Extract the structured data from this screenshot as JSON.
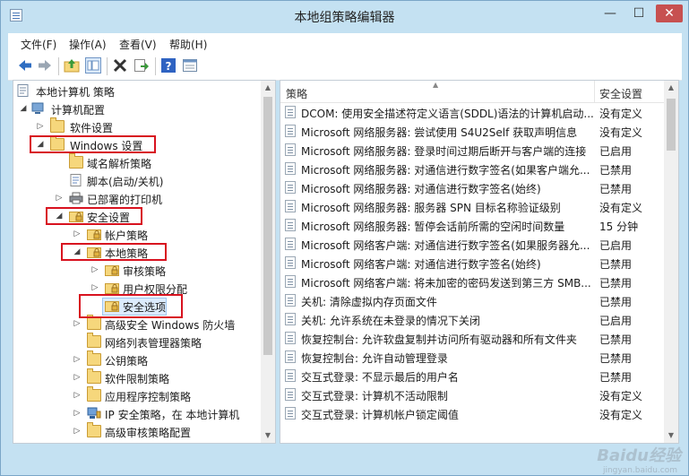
{
  "window": {
    "title": "本地组策略编辑器",
    "controls": {
      "minimize": "—",
      "maximize": "☐",
      "close": "✕"
    }
  },
  "menubar": [
    "文件(F)",
    "操作(A)",
    "查看(V)",
    "帮助(H)"
  ],
  "toolbar": [
    "back-icon",
    "forward-icon",
    "up-folder-icon",
    "show-hide-tree-icon",
    "delete-icon",
    "export-icon",
    "help-icon",
    "properties-icon"
  ],
  "tree": [
    {
      "label": "本地计算机 策略",
      "icon": "computer-policy-icon",
      "expand": "none"
    },
    {
      "label": "计算机配置",
      "icon": "computer-icon",
      "expand": "expanded"
    },
    {
      "label": "软件设置",
      "icon": "folder-icon",
      "expand": "collapsed"
    },
    {
      "label": "Windows 设置",
      "icon": "folder-icon",
      "expand": "expanded"
    },
    {
      "label": "域名解析策略",
      "icon": "folder-icon",
      "expand": "none"
    },
    {
      "label": "脚本(启动/关机)",
      "icon": "script-icon",
      "expand": "none"
    },
    {
      "label": "已部署的打印机",
      "icon": "printer-icon",
      "expand": "collapsed"
    },
    {
      "label": "安全设置",
      "icon": "security-folder-icon",
      "expand": "expanded"
    },
    {
      "label": "帐户策略",
      "icon": "security-folder-icon",
      "expand": "collapsed"
    },
    {
      "label": "本地策略",
      "icon": "security-folder-icon",
      "expand": "expanded"
    },
    {
      "label": "审核策略",
      "icon": "security-folder-icon",
      "expand": "collapsed"
    },
    {
      "label": "用户权限分配",
      "icon": "security-folder-icon",
      "expand": "collapsed"
    },
    {
      "label": "安全选项",
      "icon": "security-folder-icon",
      "expand": "none"
    },
    {
      "label": "高级安全 Windows 防火墙",
      "icon": "folder-icon",
      "expand": "collapsed"
    },
    {
      "label": "网络列表管理器策略",
      "icon": "folder-icon",
      "expand": "none"
    },
    {
      "label": "公钥策略",
      "icon": "folder-icon",
      "expand": "collapsed"
    },
    {
      "label": "软件限制策略",
      "icon": "folder-icon",
      "expand": "collapsed"
    },
    {
      "label": "应用程序控制策略",
      "icon": "folder-icon",
      "expand": "collapsed"
    },
    {
      "label": "IP 安全策略，在 本地计算机",
      "icon": "ip-security-icon",
      "expand": "collapsed"
    },
    {
      "label": "高级审核策略配置",
      "icon": "folder-icon",
      "expand": "collapsed"
    }
  ],
  "table": {
    "columns": [
      "策略",
      "安全设置"
    ],
    "rows": [
      [
        "DCOM: 使用安全描述符定义语言(SDDL)语法的计算机启动...",
        "没有定义"
      ],
      [
        "Microsoft 网络服务器: 尝试使用 S4U2Self 获取声明信息",
        "没有定义"
      ],
      [
        "Microsoft 网络服务器: 登录时间过期后断开与客户端的连接",
        "已启用"
      ],
      [
        "Microsoft 网络服务器: 对通信进行数字签名(如果客户端允...",
        "已禁用"
      ],
      [
        "Microsoft 网络服务器: 对通信进行数字签名(始终)",
        "已禁用"
      ],
      [
        "Microsoft 网络服务器: 服务器 SPN 目标名称验证级别",
        "没有定义"
      ],
      [
        "Microsoft 网络服务器: 暂停会话前所需的空闲时间数量",
        "15 分钟"
      ],
      [
        "Microsoft 网络客户端: 对通信进行数字签名(如果服务器允...",
        "已启用"
      ],
      [
        "Microsoft 网络客户端: 对通信进行数字签名(始终)",
        "已禁用"
      ],
      [
        "Microsoft 网络客户端: 将未加密的密码发送到第三方 SMB...",
        "已禁用"
      ],
      [
        "关机: 清除虚拟内存页面文件",
        "已禁用"
      ],
      [
        "关机: 允许系统在未登录的情况下关闭",
        "已启用"
      ],
      [
        "恢复控制台: 允许软盘复制并访问所有驱动器和所有文件夹",
        "已禁用"
      ],
      [
        "恢复控制台: 允许自动管理登录",
        "已禁用"
      ],
      [
        "交互式登录: 不显示最后的用户名",
        "已禁用"
      ],
      [
        "交互式登录: 计算机不活动限制",
        "没有定义"
      ],
      [
        "交互式登录: 计算机帐户锁定阈值",
        "没有定义"
      ]
    ]
  },
  "watermark": {
    "brand": "Baidu经验",
    "url": "jingyan.baidu.com"
  }
}
